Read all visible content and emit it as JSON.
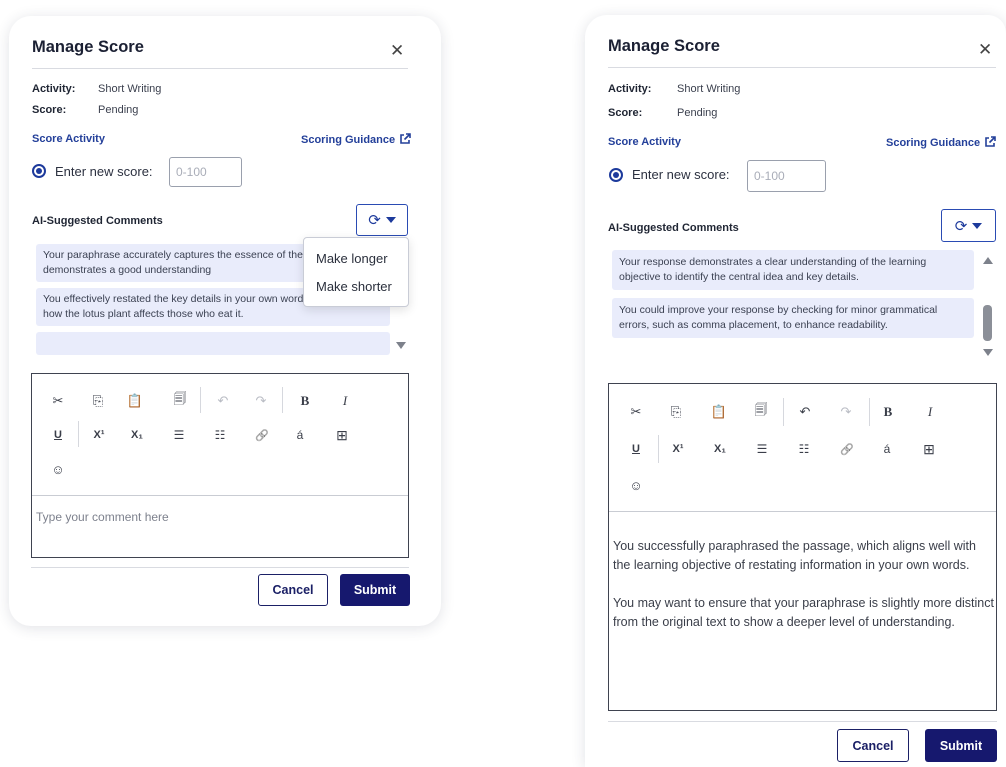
{
  "icons": {
    "close": "close-icon",
    "external_link": "external-link-icon",
    "regenerate": "refresh-icon",
    "dropdown": "caret-down-icon"
  },
  "colors": {
    "accent_blue": "#24409a",
    "submit_navy": "#16186e",
    "comment_bg": "#e9ecfb"
  },
  "toolbar_icons": {
    "row1": [
      {
        "name": "cut-icon",
        "glyph": "✂"
      },
      {
        "name": "copy-icon",
        "glyph": "⎘"
      },
      {
        "name": "paste-icon",
        "glyph": "📋"
      },
      {
        "name": "paste-text-icon",
        "glyph": "🗐"
      },
      {
        "name": "undo-icon",
        "glyph": "↶"
      },
      {
        "name": "redo-icon",
        "glyph": "↷"
      },
      {
        "name": "bold-icon",
        "glyph": "B"
      },
      {
        "name": "italic-icon",
        "glyph": "I"
      }
    ],
    "row2": [
      {
        "name": "underline-icon",
        "glyph": "U"
      },
      {
        "name": "superscript-icon",
        "glyph": "X¹"
      },
      {
        "name": "subscript-icon",
        "glyph": "X₁"
      },
      {
        "name": "bulleted-list-icon",
        "glyph": "☰"
      },
      {
        "name": "numbered-list-icon",
        "glyph": "☷"
      },
      {
        "name": "link-icon",
        "glyph": "🔗"
      },
      {
        "name": "special-character-icon",
        "glyph": "á"
      },
      {
        "name": "table-icon",
        "glyph": "⊞"
      }
    ],
    "row3": [
      {
        "name": "emoji-icon",
        "glyph": "☺"
      }
    ]
  },
  "left": {
    "title": "Manage Score",
    "close_glyph": "✕",
    "activity_label": "Activity:",
    "activity_value": "Short Writing",
    "score_label": "Score:",
    "score_value": "Pending",
    "score_activity_link": "Score Activity",
    "scoring_guidance_link": "Scoring Guidance",
    "enter_new_score_label": "Enter new score:",
    "score_placeholder": "0-100",
    "ai_comments_label": "AI-Suggested Comments",
    "regen_glyph": "⟳",
    "comments": [
      "Your paraphrase accurately captures the essence of the passage and demonstrates a good understanding",
      "You effectively restated the key details in your own words, explaining how the lotus plant affects those who eat it.",
      "."
    ],
    "menu": {
      "items": [
        "Make longer",
        "Make shorter"
      ]
    },
    "editor": {
      "placeholder": "Type your comment here"
    },
    "cancel_label": "Cancel",
    "submit_label": "Submit"
  },
  "right": {
    "title": "Manage Score",
    "close_glyph": "✕",
    "activity_label": "Activity:",
    "activity_value": "Short Writing",
    "score_label": "Score:",
    "score_value": "Pending",
    "score_activity_link": "Score Activity",
    "scoring_guidance_link": "Scoring Guidance",
    "enter_new_score_label": "Enter new score:",
    "score_placeholder": "0-100",
    "ai_comments_label": "AI-Suggested Comments",
    "regen_glyph": "⟳",
    "comments": [
      "Your response demonstrates a clear understanding of the learning objective to identify the central idea and key details.",
      "You could improve your response by checking for minor grammatical errors, such as comma placement, to enhance readability."
    ],
    "editor": {
      "paragraph_1": "You successfully paraphrased the passage, which aligns well with the learning objective of restating information in your own words.",
      "paragraph_2": "You may want to ensure that your paraphrase is slightly more distinct from the original text to show a deeper level of understanding."
    },
    "cancel_label": "Cancel",
    "submit_label": "Submit"
  }
}
